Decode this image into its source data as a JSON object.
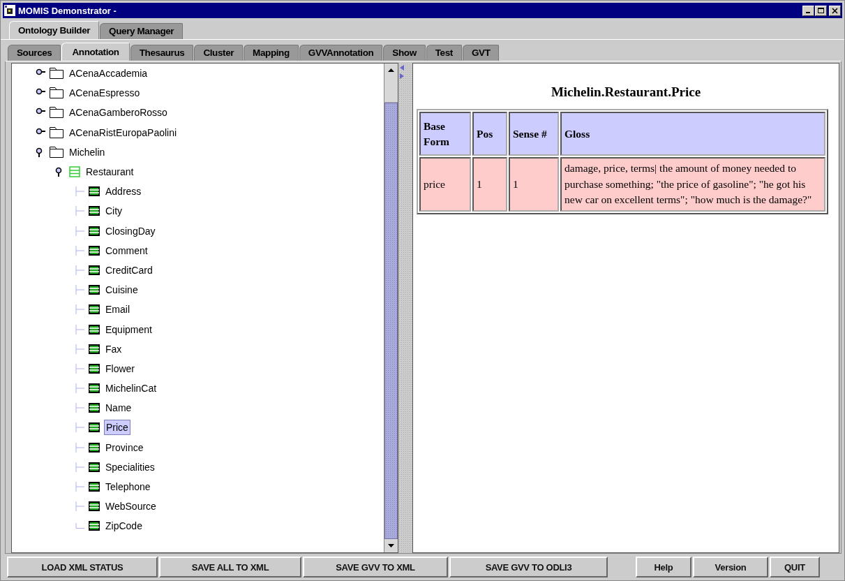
{
  "window": {
    "title": "MOMIS Demonstrator -"
  },
  "main_tabs": [
    {
      "label": "Ontology Builder",
      "selected": true
    },
    {
      "label": "Query Manager",
      "selected": false
    }
  ],
  "sub_tabs": [
    {
      "label": "Sources",
      "selected": false
    },
    {
      "label": "Annotation",
      "selected": true
    },
    {
      "label": "Thesaurus",
      "selected": false
    },
    {
      "label": "Cluster",
      "selected": false
    },
    {
      "label": "Mapping",
      "selected": false
    },
    {
      "label": "GVVAnnotation",
      "selected": false
    },
    {
      "label": "Show",
      "selected": false
    },
    {
      "label": "Test",
      "selected": false
    },
    {
      "label": "GVT",
      "selected": false
    }
  ],
  "tree": [
    {
      "label": "ACenaAccademia",
      "kind": "source",
      "expanded": false,
      "selected": false
    },
    {
      "label": "ACenaEspresso",
      "kind": "source",
      "expanded": false,
      "selected": false
    },
    {
      "label": "ACenaGamberoRosso",
      "kind": "source",
      "expanded": false,
      "selected": false
    },
    {
      "label": "ACenaRistEuropaPaolini",
      "kind": "source",
      "expanded": false,
      "selected": false
    },
    {
      "label": "Michelin",
      "kind": "source",
      "expanded": true,
      "selected": false,
      "children": [
        {
          "label": "Restaurant",
          "kind": "class",
          "expanded": true,
          "selected": false,
          "children": [
            {
              "label": "Address",
              "kind": "attribute",
              "selected": false
            },
            {
              "label": "City",
              "kind": "attribute",
              "selected": false
            },
            {
              "label": "ClosingDay",
              "kind": "attribute",
              "selected": false
            },
            {
              "label": "Comment",
              "kind": "attribute",
              "selected": false
            },
            {
              "label": "CreditCard",
              "kind": "attribute",
              "selected": false
            },
            {
              "label": "Cuisine",
              "kind": "attribute",
              "selected": false
            },
            {
              "label": "Email",
              "kind": "attribute",
              "selected": false
            },
            {
              "label": "Equipment",
              "kind": "attribute",
              "selected": false
            },
            {
              "label": "Fax",
              "kind": "attribute",
              "selected": false
            },
            {
              "label": "Flower",
              "kind": "attribute",
              "selected": false
            },
            {
              "label": "MichelinCat",
              "kind": "attribute",
              "selected": false
            },
            {
              "label": "Name",
              "kind": "attribute",
              "selected": false
            },
            {
              "label": "Price",
              "kind": "attribute",
              "selected": true
            },
            {
              "label": "Province",
              "kind": "attribute",
              "selected": false
            },
            {
              "label": "Specialities",
              "kind": "attribute",
              "selected": false
            },
            {
              "label": "Telephone",
              "kind": "attribute",
              "selected": false
            },
            {
              "label": "WebSource",
              "kind": "attribute",
              "selected": false
            },
            {
              "label": "ZipCode",
              "kind": "attribute",
              "selected": false
            }
          ]
        }
      ]
    }
  ],
  "detail": {
    "title": "Michelin.Restaurant.Price",
    "table": {
      "columns": [
        "Base Form",
        "Pos",
        "Sense #",
        "Gloss"
      ],
      "rows": [
        [
          "price",
          "1",
          "1",
          "damage, price, terms| the amount of money needed to purchase something; \"the price of gasoline\"; \"he got his new car on excellent terms\"; \"how much is the damage?\""
        ]
      ]
    }
  },
  "buttons_left": [
    "LOAD XML STATUS",
    "SAVE ALL TO XML",
    "SAVE GVV TO XML",
    "SAVE GVV TO ODLI3"
  ],
  "buttons_right": [
    "Help",
    "Version",
    "QUIT"
  ]
}
